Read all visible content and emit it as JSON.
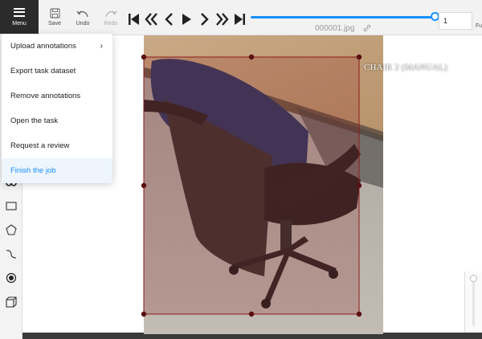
{
  "toolbar": {
    "menu_label": "Menu",
    "save_label": "Save",
    "undo_label": "Undo",
    "redo_label": "Redo",
    "frame_number": "1",
    "fullscreen_label_partial": "Fu",
    "filename": "000001.jpg",
    "slider_progress": 1.0,
    "accent_color": "#1890ff"
  },
  "player": {
    "buttons": [
      "first-frame",
      "previous-step",
      "previous-frame",
      "play",
      "next-frame",
      "next-step",
      "last-frame"
    ]
  },
  "menu": {
    "items": [
      {
        "label": "Upload annotations",
        "has_submenu": true
      },
      {
        "label": "Export task dataset"
      },
      {
        "label": "Remove annotations"
      },
      {
        "label": "Open the task"
      },
      {
        "label": "Request a review"
      },
      {
        "label": "Finish the job",
        "active": true
      }
    ]
  },
  "left_tools": [
    "tag-icon",
    "rectangle-icon",
    "polygon-icon",
    "polyline-icon",
    "points-icon",
    "cuboid-icon"
  ],
  "annotation": {
    "label": "CHAIR 2 (MANUAL)",
    "box_color": "#8b1a1a"
  }
}
